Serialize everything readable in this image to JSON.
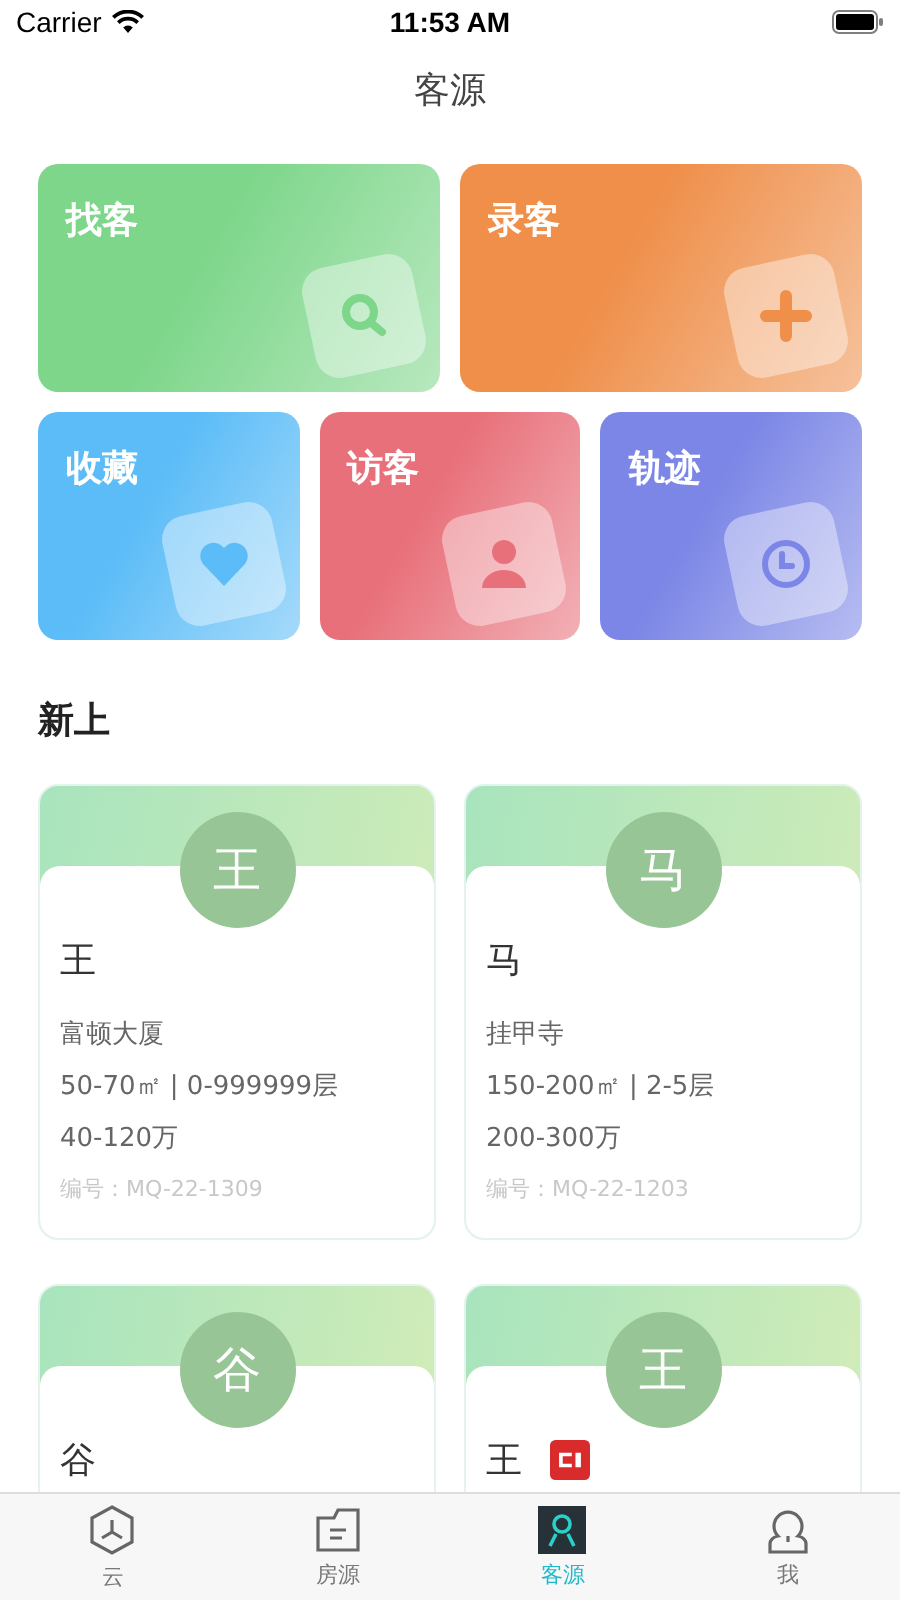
{
  "status_bar": {
    "carrier": "Carrier",
    "time": "11:53 AM"
  },
  "title": "客源",
  "tiles": [
    {
      "label": "找客",
      "kind": "search",
      "color": "#7dd68a"
    },
    {
      "label": "录客",
      "kind": "add",
      "color": "#ef8f4a"
    },
    {
      "label": "收藏",
      "kind": "favorite",
      "color": "#5bbcf7"
    },
    {
      "label": "访客",
      "kind": "visitor",
      "color": "#e8707a"
    },
    {
      "label": "轨迹",
      "kind": "track",
      "color": "#7b86e6"
    }
  ],
  "section_title": "新上",
  "clients": [
    {
      "avatar": "王",
      "name": "王",
      "flagged": false,
      "building": "富顿大厦",
      "spec": "50-70㎡ | 0-999999层",
      "budget": "40-120万",
      "code": "编号：MQ-22-1309"
    },
    {
      "avatar": "马",
      "name": "马",
      "flagged": false,
      "building": "挂甲寺",
      "spec": "150-200㎡ | 2-5层",
      "budget": "200-300万",
      "code": "编号：MQ-22-1203"
    },
    {
      "avatar": "谷",
      "name": "谷",
      "flagged": false
    },
    {
      "avatar": "王",
      "name": "王",
      "flagged": true
    }
  ],
  "tab_bar": [
    {
      "label": "云",
      "kind": "cloud",
      "selected": false
    },
    {
      "label": "房源",
      "kind": "house",
      "selected": false
    },
    {
      "label": "客源",
      "kind": "client",
      "selected": true
    },
    {
      "label": "我",
      "kind": "me",
      "selected": false
    }
  ]
}
